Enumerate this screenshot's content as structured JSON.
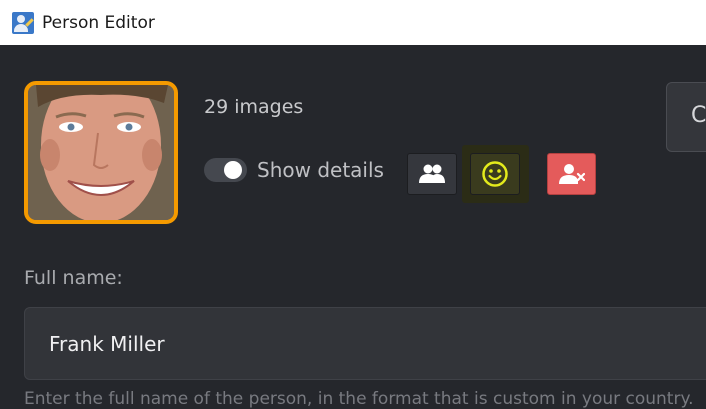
{
  "window": {
    "title": "Person Editor"
  },
  "person": {
    "image_count": "29 images"
  },
  "details_toggle": {
    "label": "Show details",
    "on": true
  },
  "action_buttons": [
    {
      "icon": "people-icon"
    },
    {
      "icon": "smiley-icon",
      "active": true
    },
    {
      "icon": "remove-person-icon"
    }
  ],
  "side_button": {
    "label": "C"
  },
  "full_name": {
    "label": "Full name:",
    "value": "Frank Miller",
    "hint": "Enter the full name of the person, in the format that is custom in your country."
  },
  "colors": {
    "accent": "#f59a00",
    "danger": "#e45b5b",
    "highlight": "#e3ea1c",
    "background": "#25272c"
  }
}
